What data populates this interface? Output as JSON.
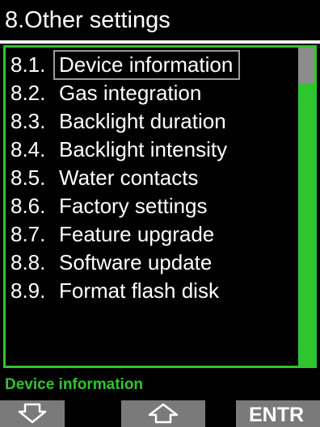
{
  "header": {
    "title": "8.Other settings"
  },
  "menu": {
    "items": [
      {
        "number": "8.1.",
        "label": "Device information",
        "selected": true
      },
      {
        "number": "8.2.",
        "label": "Gas integration",
        "selected": false
      },
      {
        "number": "8.3.",
        "label": "Backlight duration",
        "selected": false
      },
      {
        "number": "8.4.",
        "label": "Backlight intensity",
        "selected": false
      },
      {
        "number": "8.5.",
        "label": "Water contacts",
        "selected": false
      },
      {
        "number": "8.6.",
        "label": "Factory settings",
        "selected": false
      },
      {
        "number": "8.7.",
        "label": "Feature upgrade",
        "selected": false
      },
      {
        "number": "8.8.",
        "label": "Software update",
        "selected": false
      },
      {
        "number": "8.9.",
        "label": "Format flash disk",
        "selected": false
      }
    ]
  },
  "status": {
    "text": "Device information"
  },
  "softkeys": {
    "left_icon": "arrow-down-icon",
    "middle_icon": "arrow-up-icon",
    "right_label": "ENTR"
  },
  "colors": {
    "accent": "#2fc52f",
    "background": "#000000",
    "softkey": "#7a7a7a",
    "text": "#ffffff"
  }
}
